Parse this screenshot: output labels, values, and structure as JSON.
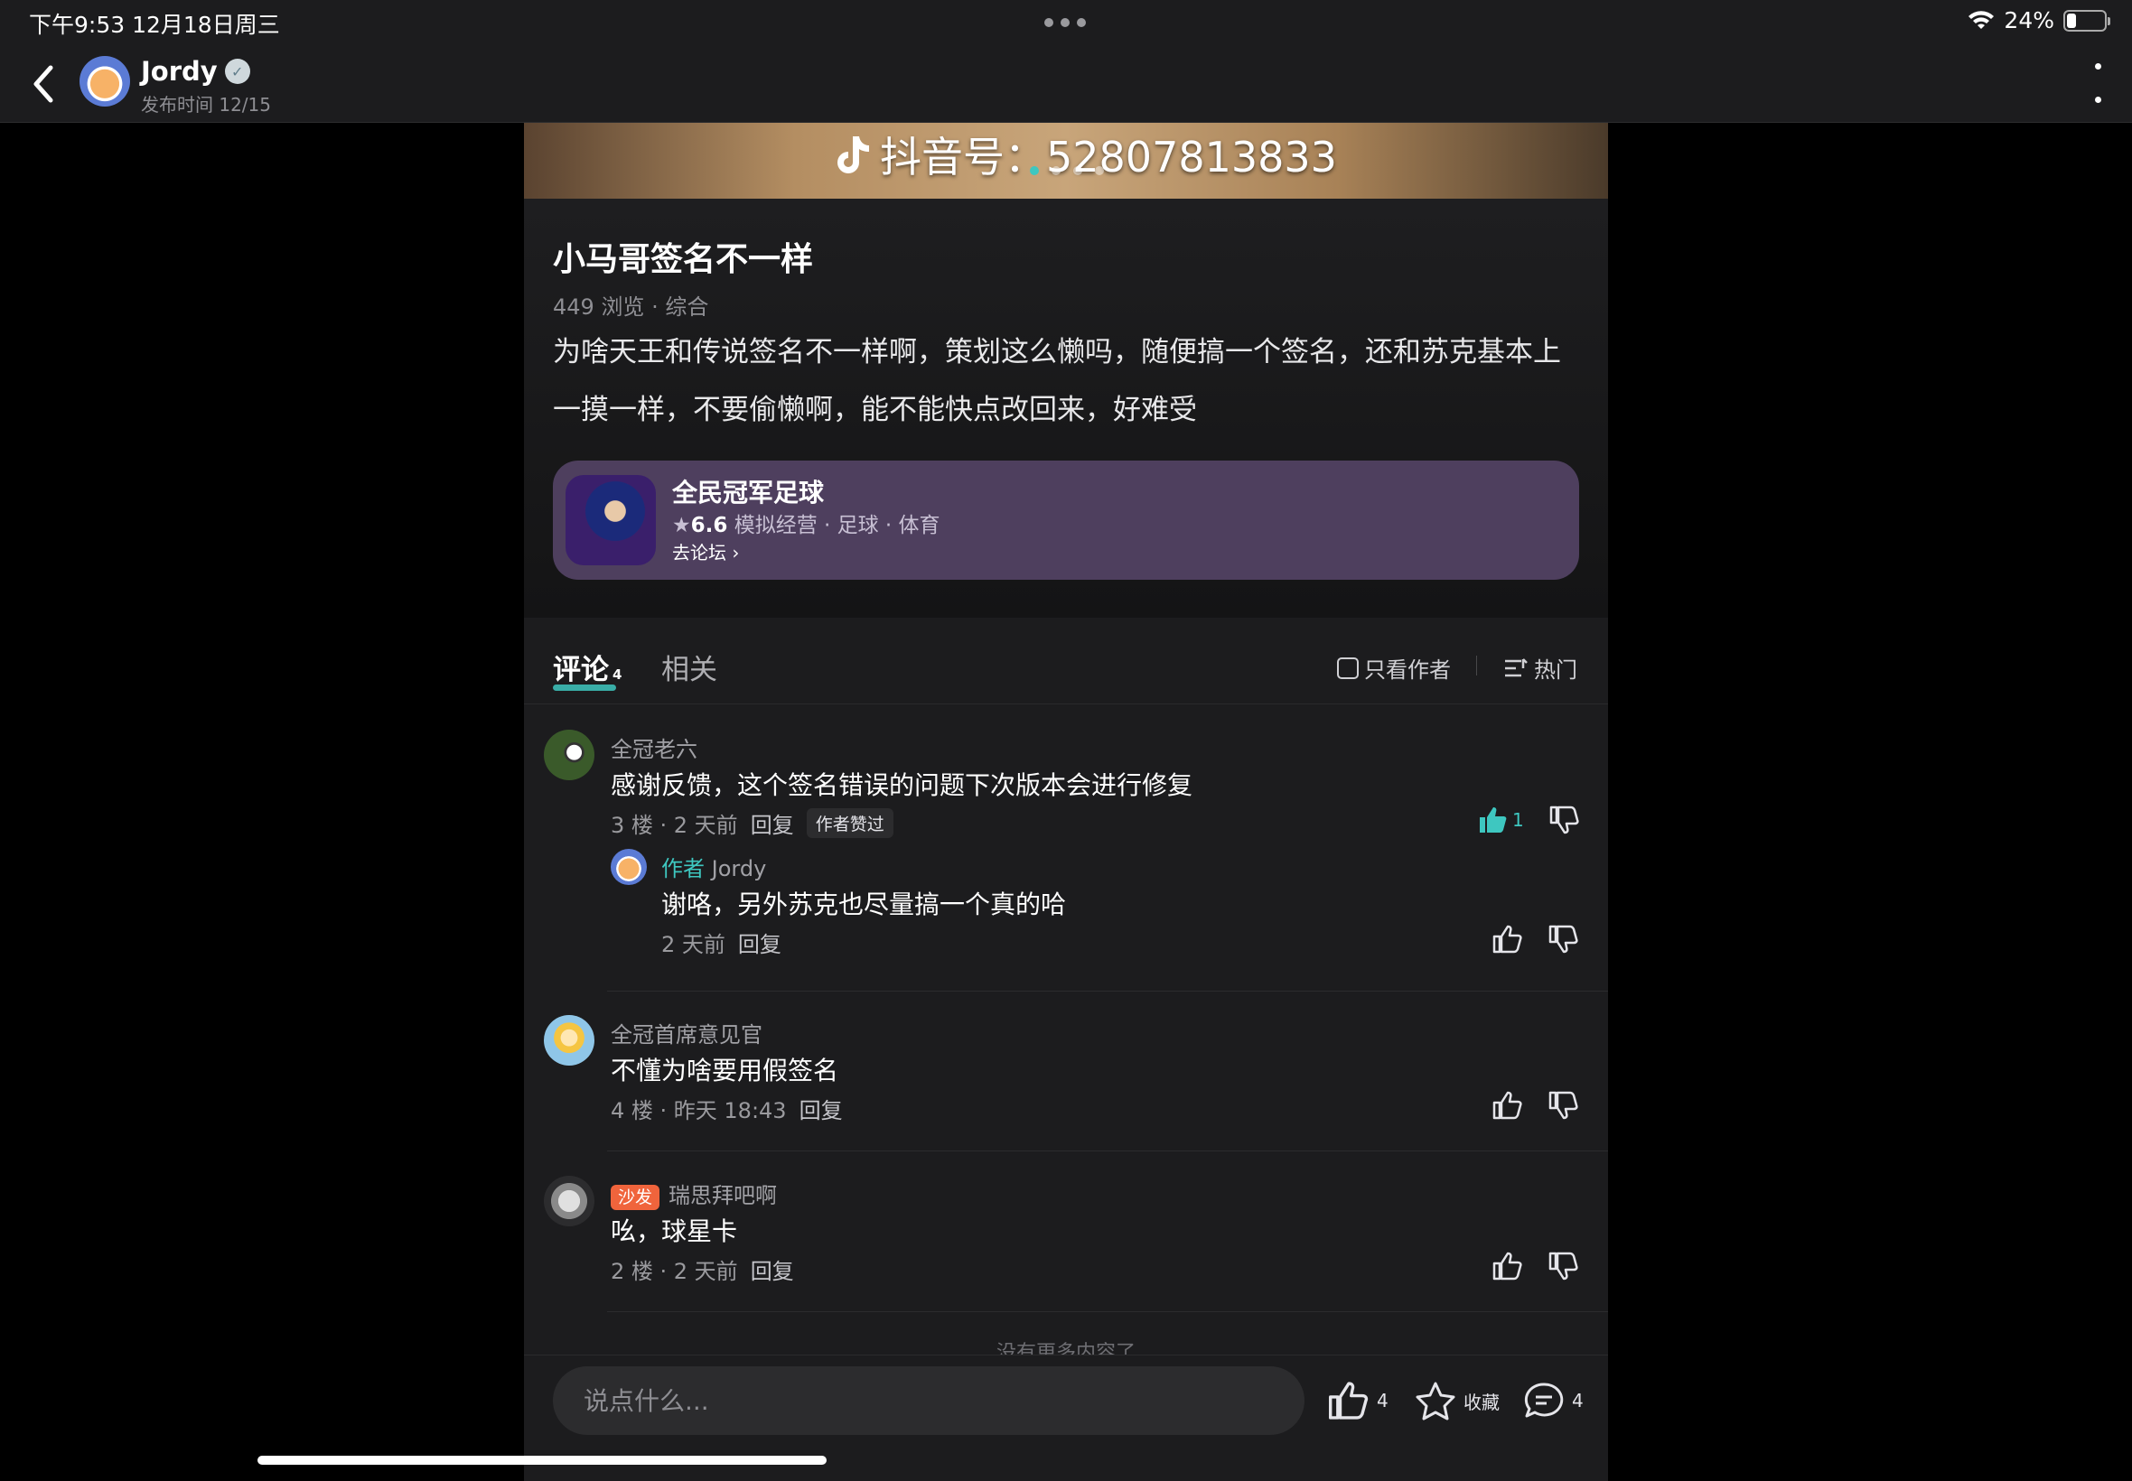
{
  "status_bar": {
    "time": "下午9:53   12月18日周三",
    "battery_percent": "24%",
    "battery_level": 0.24
  },
  "nav": {
    "author_name": "Jordy",
    "publish_time": "发布时间 12/15"
  },
  "banner": {
    "text": "抖音号：52807813833",
    "page_count": 4,
    "active_page": 1
  },
  "post": {
    "title": "小马哥签名不一样",
    "meta": "449 浏览 · 综合",
    "body": "为啥天王和传说签名不一样啊，策划这么懒吗，随便搞一个签名，还和苏克基本上一摸一样，不要偷懒啊，能不能快点改回来，好难受",
    "game": {
      "name": "全民冠军足球",
      "rating": "6.6",
      "tags": "模拟经营 · 足球 · 体育",
      "link": "去论坛"
    }
  },
  "comments_header": {
    "tab_comments": "评论",
    "comment_count": "4",
    "tab_related": "相关",
    "only_author": "只看作者",
    "sort": "热门"
  },
  "comments": [
    {
      "name": "全冠老六",
      "text": "感谢反馈，这个签名错误的问题下次版本会进行修复",
      "floor": "3 楼 · 2 天前",
      "reply": "回复",
      "badge": "作者赞过",
      "likes": "1",
      "sub": {
        "author_tag": "作者",
        "name": "Jordy",
        "text": "谢咯，另外苏克也尽量搞一个真的哈",
        "time": "2 天前",
        "reply": "回复"
      }
    },
    {
      "name": "全冠首席意见官",
      "text": "不懂为啥要用假签名",
      "floor": "4 楼 · 昨天 18:43",
      "reply": "回复"
    },
    {
      "tag": "沙发",
      "name": "瑞思拜吧啊",
      "text": "吆，球星卡",
      "floor": "2 楼 · 2 天前",
      "reply": "回复"
    }
  ],
  "no_more": "没有更多内容了",
  "bottom_bar": {
    "placeholder": "说点什么...",
    "likes": "4",
    "favorite": "收藏",
    "comments": "4"
  },
  "colors": {
    "accent": "#3ec7c0",
    "background": "#1c1c1e",
    "game_card": "#4e3f5e",
    "sofa_badge": "#f0643c"
  }
}
